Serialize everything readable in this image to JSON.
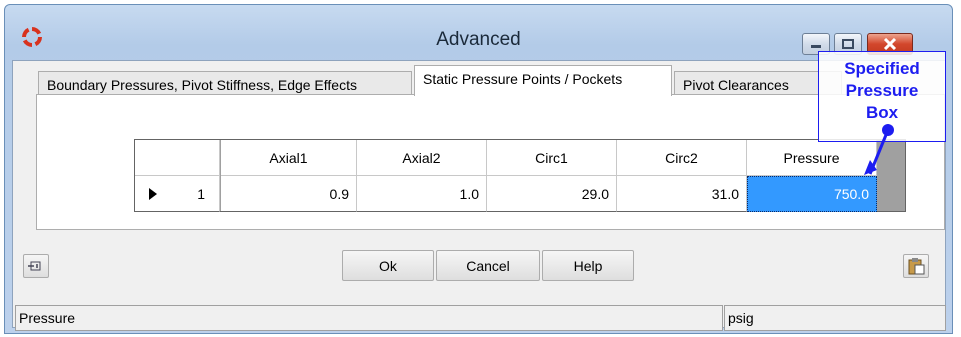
{
  "window": {
    "title": "Advanced",
    "accent_title": "#1b2a3a"
  },
  "tabs": [
    {
      "label": "Boundary Pressures, Pivot Stiffness, Edge Effects",
      "selected": false
    },
    {
      "label": "Static Pressure Points / Pockets",
      "selected": true
    },
    {
      "label": "Pivot Clearances",
      "selected": false
    }
  ],
  "grid": {
    "columns": [
      "Axial1",
      "Axial2",
      "Circ1",
      "Circ2",
      "Pressure"
    ],
    "rows": [
      {
        "index": "1",
        "indicator": "row-pointer-icon",
        "values": [
          "0.9",
          "1.0",
          "29.0",
          "31.0",
          "750.0"
        ]
      }
    ],
    "selected_cell_color": "#3399ff"
  },
  "callout": {
    "lines": [
      "Specified",
      "Pressure",
      "Box"
    ],
    "color": "#1d1df0"
  },
  "buttons": {
    "ok": "Ok",
    "cancel": "Cancel",
    "help": "Help",
    "pin_icon": "pin-icon",
    "paste_icon": "clipboard-paste-icon"
  },
  "status": {
    "left": "Pressure",
    "right": "psig"
  }
}
